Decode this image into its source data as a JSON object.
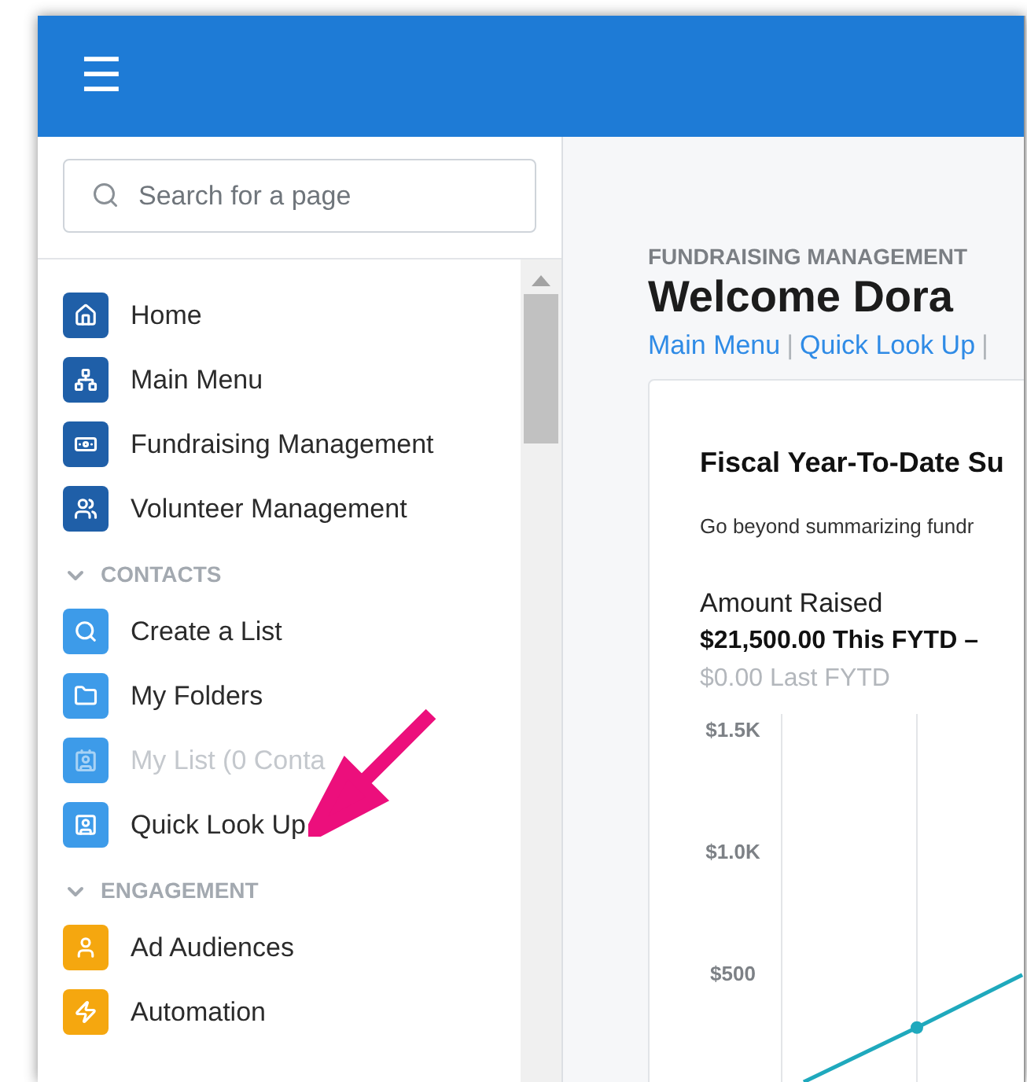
{
  "header": {
    "menu_icon": "☰"
  },
  "search": {
    "placeholder": "Search for a page"
  },
  "sidebar": {
    "items": [
      {
        "label": "Home",
        "kind": "home",
        "color": "#1f5fa8",
        "disabled": false
      },
      {
        "label": "Main Menu",
        "kind": "sitemap",
        "color": "#1f5fa8",
        "disabled": false
      },
      {
        "label": "Fundraising Management",
        "kind": "money",
        "color": "#1f5fa8",
        "disabled": false
      },
      {
        "label": "Volunteer Management",
        "kind": "people",
        "color": "#1f5fa8",
        "disabled": false
      }
    ],
    "sections": [
      {
        "title": "CONTACTS",
        "expanded": true,
        "items": [
          {
            "label": "Create a List",
            "kind": "search",
            "color": "#3d9be9",
            "disabled": false
          },
          {
            "label": "My Folders",
            "kind": "folder",
            "color": "#3d9be9",
            "disabled": false
          },
          {
            "label": "My List (0 Conta",
            "kind": "list",
            "color": "#3d9be9",
            "disabled": true
          },
          {
            "label": "Quick Look Up",
            "kind": "card",
            "color": "#3d9be9",
            "disabled": false
          }
        ]
      },
      {
        "title": "ENGAGEMENT",
        "expanded": true,
        "items": [
          {
            "label": "Ad Audiences",
            "kind": "user",
            "color": "#f5a70f",
            "disabled": false
          },
          {
            "label": "Automation",
            "kind": "bolt",
            "color": "#f5a70f",
            "disabled": false
          }
        ]
      }
    ]
  },
  "main": {
    "eyebrow": "FUNDRAISING MANAGEMENT",
    "title": "Welcome Dora",
    "links": [
      {
        "label": "Main Menu"
      },
      {
        "label": "Quick Look Up"
      }
    ],
    "separator": "|",
    "card": {
      "title": "Fiscal Year-To-Date Su",
      "description": "Go beyond summarizing fundr",
      "metric_label": "Amount Raised",
      "this_fytd": "$21,500.00 This FYTD –",
      "last_fytd": "$0.00 Last FYTD",
      "chart": {
        "y_labels": [
          "$1.5K",
          "$1.0K",
          "$500"
        ]
      }
    }
  },
  "annotation": {
    "color": "#ec0f7c"
  }
}
